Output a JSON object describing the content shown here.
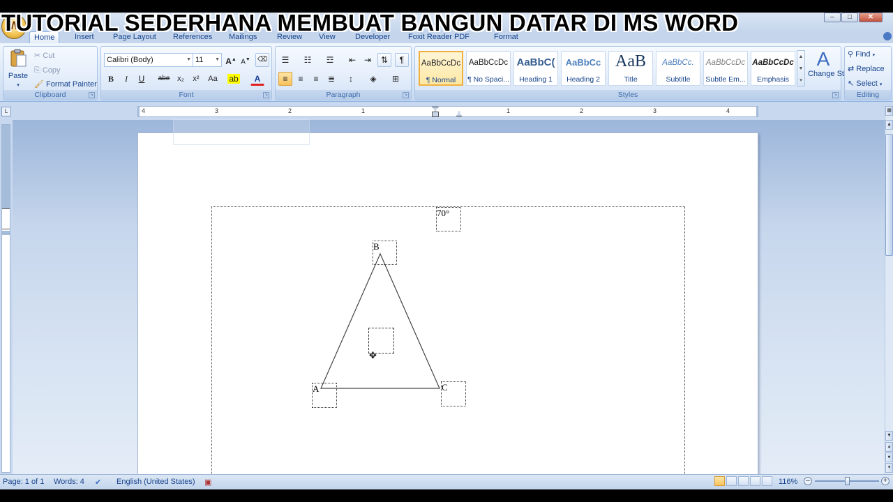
{
  "overlay_title": "TUTORIAL SEDERHANA MEMBUAT BANGUN DATAR DI MS WORD",
  "window": {
    "minimize": "–",
    "maximize": "□",
    "close": "✕"
  },
  "tabs": [
    "Home",
    "Insert",
    "Page Layout",
    "References",
    "Mailings",
    "Review",
    "View",
    "Developer",
    "Foxit Reader PDF",
    "Format"
  ],
  "clipboard": {
    "paste": "Paste",
    "cut": "Cut",
    "copy": "Copy",
    "format_painter": "Format Painter",
    "label": "Clipboard"
  },
  "font": {
    "name": "Calibri (Body)",
    "size": "11",
    "label": "Font",
    "bold": "B",
    "italic": "I",
    "underline": "U",
    "strike": "abe",
    "sub": "x₂",
    "sup": "x²",
    "case": "Aa",
    "color": "A",
    "grow": "A",
    "shrink": "A"
  },
  "paragraph": {
    "label": "Paragraph",
    "pilcrow": "¶"
  },
  "styles": {
    "label": "Styles",
    "items": [
      {
        "sample": "AaBbCcDc",
        "name": "¶ Normal"
      },
      {
        "sample": "AaBbCcDc",
        "name": "¶ No Spaci..."
      },
      {
        "sample": "AaBbC(",
        "name": "Heading 1"
      },
      {
        "sample": "AaBbCc",
        "name": "Heading 2"
      },
      {
        "sample": "AaB",
        "name": "Title"
      },
      {
        "sample": "AaBbCc.",
        "name": "Subtitle"
      },
      {
        "sample": "AaBbCcDc",
        "name": "Subtle Em..."
      },
      {
        "sample": "AaBbCcDc",
        "name": "Emphasis"
      }
    ],
    "change_styles": "Change Styles"
  },
  "editing": {
    "label": "Editing",
    "find": "Find",
    "replace": "Replace",
    "select": "Select"
  },
  "ruler": {
    "tab_button": "L",
    "numbers_left": [
      "4",
      "3",
      "2",
      "1"
    ],
    "numbers_right": [
      "1",
      "2",
      "3",
      "4"
    ]
  },
  "drawing": {
    "angle_label": "70°",
    "vertex_a": "A",
    "vertex_b": "B",
    "vertex_c": "C"
  },
  "status": {
    "page": "Page: 1 of 1",
    "words": "Words: 4",
    "language": "English (United States)",
    "zoom": "116%",
    "zoom_minus": "–",
    "zoom_plus": "+"
  },
  "colors": {
    "ribbon_text": "#15428b",
    "ribbon_bg": "#dbe8f7",
    "selected_style": "#f0b040",
    "doc_bg": "#c6d6ec"
  }
}
